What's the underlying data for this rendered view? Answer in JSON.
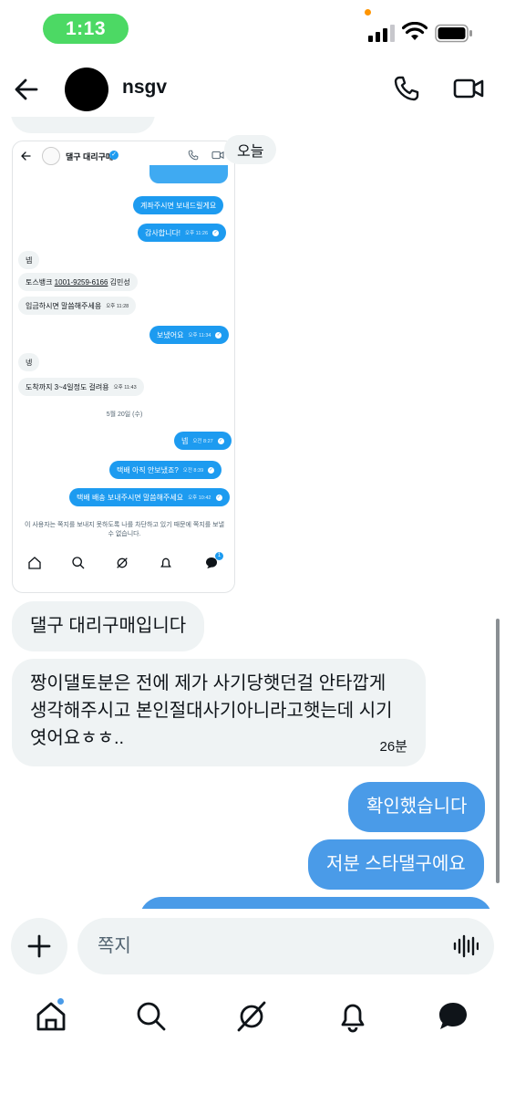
{
  "status_bar": {
    "time": "1:13"
  },
  "header": {
    "contact_name": "nsgv"
  },
  "date_chip": "오늘",
  "embedded_screenshot": {
    "contact_name": "댈구 대리구매",
    "messages": [
      {
        "dir": "out",
        "text": "계좌주시면 보내드릴게요",
        "time": ""
      },
      {
        "dir": "out",
        "text": "감사합니다!",
        "time": "오후 11:26"
      },
      {
        "dir": "in",
        "text": "넵",
        "time": ""
      },
      {
        "dir": "in",
        "text_prefix": "토스뱅크 ",
        "account": "1001-9259-6166",
        "text_suffix": " 김민성",
        "time": ""
      },
      {
        "dir": "in",
        "text": "입금하시면 말씀해주세용",
        "time": "오후 11:28"
      },
      {
        "dir": "out",
        "text": "보냈어요",
        "time": "오후 11:34"
      },
      {
        "dir": "in",
        "text": "넹",
        "time": ""
      },
      {
        "dir": "in",
        "text": "도착까지 3~4일정도 걸려용",
        "time": "오후 11:43"
      },
      {
        "dir": "out",
        "text": "넵",
        "time": "오전 8:27"
      },
      {
        "dir": "out",
        "text": "택배 아직 안보냈죠?",
        "time": "오전 8:39"
      },
      {
        "dir": "out",
        "text": "택배 배송 보내주시면 말씀해주세요",
        "time": "오후 10:42"
      }
    ],
    "date_divider": "5월 20일 (수)",
    "notice": "이 사용자는 쪽지를 보내지 못하도록 나를 차단하고 있기 때문에 쪽지를 보낼 수 없습니다.",
    "badge_count": "1"
  },
  "messages": [
    {
      "dir": "in",
      "text": "댈구 대리구매입니다"
    },
    {
      "dir": "in",
      "text": "짱이댈토분은 전에 제가 사기당햇던걸 안타깝게 생각해주시고 본인절대사기아니라고햇는데 시기엿어요ㅎㅎ..",
      "time": "26분"
    },
    {
      "dir": "out",
      "text": "확인했습니다"
    },
    {
      "dir": "out",
      "text": "저분 스타댈구에요"
    }
  ],
  "compose": {
    "placeholder": "쪽지"
  },
  "icons": {
    "back": "arrow-left-icon",
    "call": "phone-icon",
    "video": "video-camera-icon",
    "add": "plus-icon",
    "voice": "voice-waveform-icon",
    "nav": [
      "home-icon",
      "search-icon",
      "grok-icon",
      "bell-icon",
      "messages-icon"
    ]
  },
  "colors": {
    "accent": "#4a9be8",
    "time_pill": "#4cd964",
    "bubble_in": "#eff3f4"
  }
}
